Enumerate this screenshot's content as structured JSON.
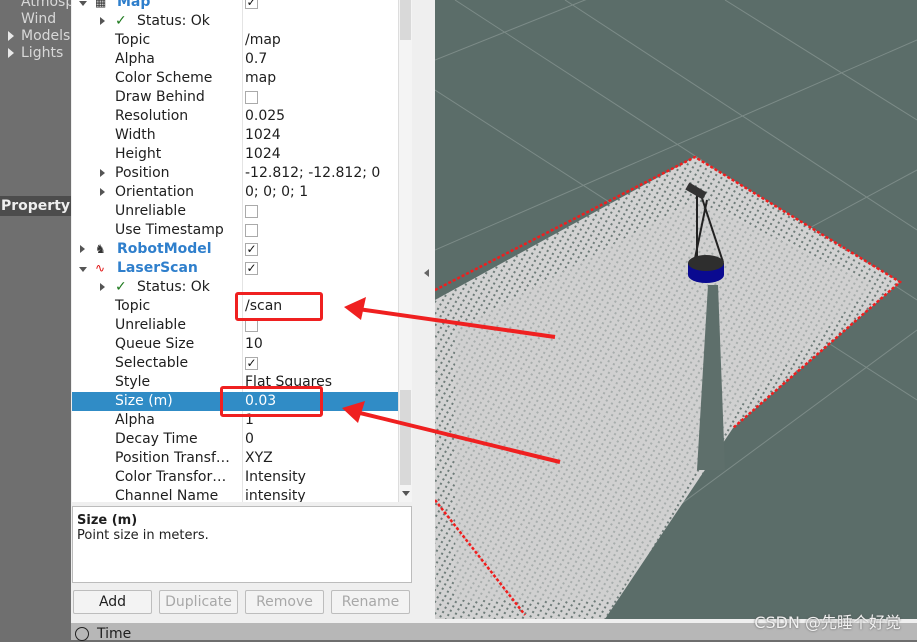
{
  "left_panel": {
    "items": [
      {
        "label": "Atmosp",
        "expandable": false
      },
      {
        "label": "Wind",
        "expandable": false
      },
      {
        "label": "Models",
        "expandable": true
      },
      {
        "label": "Lights",
        "expandable": true
      }
    ],
    "property_header": "Property"
  },
  "tree": {
    "rows": [
      {
        "name": "Map",
        "kind": "display",
        "icon": "map-grid-icon",
        "expanded": true,
        "checked": true
      },
      {
        "name": "Status: Ok",
        "kind": "status",
        "expandable": true
      },
      {
        "name": "Topic",
        "value": "/map"
      },
      {
        "name": "Alpha",
        "value": "0.7"
      },
      {
        "name": "Color Scheme",
        "value": "map"
      },
      {
        "name": "Draw Behind",
        "checkbox": false
      },
      {
        "name": "Resolution",
        "value": "0.025"
      },
      {
        "name": "Width",
        "value": "1024"
      },
      {
        "name": "Height",
        "value": "1024"
      },
      {
        "name": "Position",
        "value": "-12.812; -12.812; 0",
        "expandable": true
      },
      {
        "name": "Orientation",
        "value": "0; 0; 0; 1",
        "expandable": true
      },
      {
        "name": "Unreliable",
        "checkbox": false
      },
      {
        "name": "Use Timestamp",
        "checkbox": false
      },
      {
        "name": "RobotModel",
        "kind": "display",
        "icon": "robot-model-icon",
        "expanded": false,
        "checked": true
      },
      {
        "name": "LaserScan",
        "kind": "display",
        "icon": "laser-scan-icon",
        "expanded": true,
        "checked": true
      },
      {
        "name": "Status: Ok",
        "kind": "status",
        "expandable": true
      },
      {
        "name": "Topic",
        "value": "/scan"
      },
      {
        "name": "Unreliable",
        "checkbox": false
      },
      {
        "name": "Queue Size",
        "value": "10"
      },
      {
        "name": "Selectable",
        "checkbox": true
      },
      {
        "name": "Style",
        "value": "Flat Squares"
      },
      {
        "name": "Size (m)",
        "value": "0.03",
        "selected": true
      },
      {
        "name": "Alpha",
        "value": "1"
      },
      {
        "name": "Decay Time",
        "value": "0"
      },
      {
        "name": "Position Transf…",
        "value": "XYZ"
      },
      {
        "name": "Color Transfor…",
        "value": "Intensity"
      },
      {
        "name": "Channel Name",
        "value": "intensity"
      }
    ]
  },
  "description": {
    "title": "Size (m)",
    "text": "Point size in meters."
  },
  "buttons": {
    "add": "Add",
    "duplicate": "Duplicate",
    "remove": "Remove",
    "rename": "Rename"
  },
  "bottom": {
    "time_label": "Time"
  },
  "watermark": "CSDN @先睡个好觉",
  "colors": {
    "selection": "#308cc6",
    "display_name": "#2f7fcc",
    "annotation": "#ef2020",
    "viewport_bg": "#5b6d69",
    "status_ok": "#1e7a1e"
  }
}
